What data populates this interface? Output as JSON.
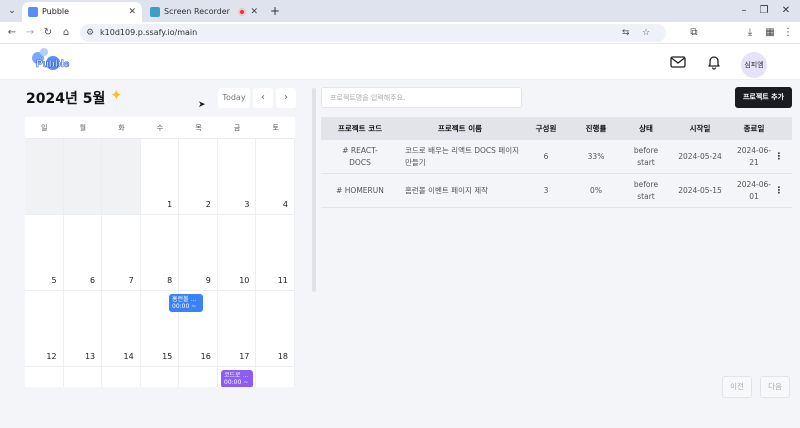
{
  "browser": {
    "tabs": [
      {
        "title": "Pubble",
        "favicon_color": "#5a8df5"
      },
      {
        "title": "Screen Recorder for Google",
        "favicon_color": "#3aa0c8"
      }
    ],
    "url": "k10d109.p.ssafy.io/main"
  },
  "header": {
    "logo_text": "Pubble",
    "avatar_label": "심피엠"
  },
  "calendar": {
    "title": "2024년 5월",
    "today_label": "Today",
    "prev_label": "‹",
    "next_label": "›",
    "weekdays": [
      "일",
      "월",
      "화",
      "수",
      "목",
      "금",
      "토"
    ],
    "days": [
      "",
      "",
      "",
      "1",
      "2",
      "3",
      "4",
      "5",
      "6",
      "7",
      "8",
      "9",
      "10",
      "11",
      "12",
      "13",
      "14",
      "15",
      "16",
      "17",
      "18",
      "",
      "",
      "",
      "",
      "",
      "",
      ""
    ],
    "events": [
      {
        "title": "홈런볼 ...",
        "time": "00:00 ~",
        "color": "#3b82f6"
      },
      {
        "title": "코드로 ...",
        "time": "00:00 ~",
        "color": "#8b5cf6"
      }
    ]
  },
  "projects": {
    "search_placeholder": "프로젝트명을 입력해주요.",
    "add_button": "프로젝트 추가",
    "columns": [
      "프로젝트 코드",
      "프로젝트 이름",
      "구성원",
      "진행률",
      "상태",
      "시작일",
      "종료일"
    ],
    "rows": [
      {
        "code": "# REACT-DOCS",
        "name": "코드로 배우는 리액트 DOCS 페이지 만들기",
        "members": "6",
        "progress": "33%",
        "status": "before start",
        "start": "2024-05-24",
        "end": "2024-06-21"
      },
      {
        "code": "# HOMERUN",
        "name": "홈런볼 이벤트 페이지 제작",
        "members": "3",
        "progress": "0%",
        "status": "before start",
        "start": "2024-05-15",
        "end": "2024-06-01"
      }
    ],
    "prev_page": "이전",
    "next_page": "다음"
  }
}
